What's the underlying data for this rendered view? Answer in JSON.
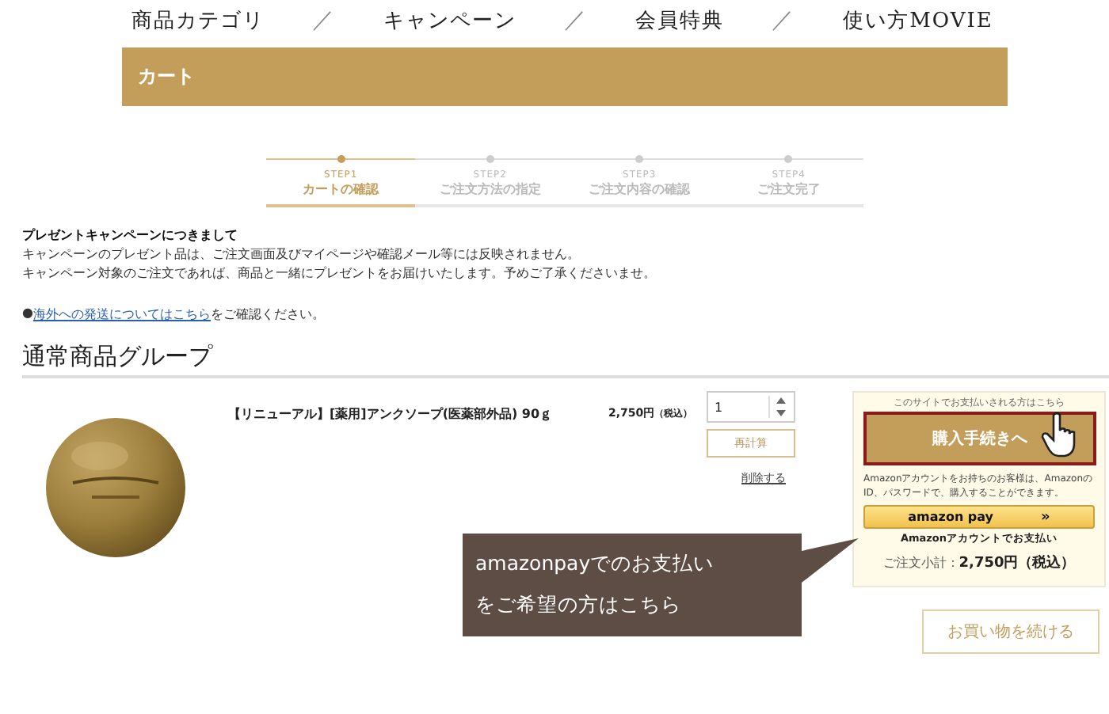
{
  "nav": [
    {
      "label": "商品カテゴリ"
    },
    {
      "label": "キャンペーン"
    },
    {
      "label": "会員特典"
    },
    {
      "label": "使い方MOVIE"
    }
  ],
  "nav_separator": "／",
  "header": {
    "title": "カート"
  },
  "steps": [
    {
      "step": "STEP1",
      "label": "カートの確認",
      "selected": true
    },
    {
      "step": "STEP2",
      "label": "ご注文方法の指定",
      "selected": false
    },
    {
      "step": "STEP3",
      "label": "ご注文内容の確認",
      "selected": false
    },
    {
      "step": "STEP4",
      "label": "ご注文完了",
      "selected": false
    }
  ],
  "notice": {
    "title": "プレゼントキャンペーンにつきまして",
    "lines": [
      "キャンペーンのプレゼント品は、ご注文画面及びマイページや確認メール等には反映されません。",
      "キャンペーン対象のご注文であれば、商品と一緒にプレゼントをお届けいたします。予めご了承くださいませ。"
    ]
  },
  "overseas": {
    "bullet": "●",
    "link": "海外への発送についてはこちら",
    "suffix": "をご確認ください。"
  },
  "group_title": "通常商品グループ",
  "item": {
    "name": "【リニューアル】[薬用]アンクソープ(医薬部外品) 90ｇ",
    "price": "2,750円",
    "tax": "（税込）",
    "quantity": "1",
    "recalc": "再計算",
    "delete": "削除する"
  },
  "checkout": {
    "intro": "このサイトでお支払いされる方はこちら",
    "purchase": "購入手続きへ",
    "amazon_note": "Amazonアカウントをお持ちのお客様は、AmazonのID、パスワードで、購入することができます。",
    "amazon_button": "amazon pay",
    "amazon_arrow": "»",
    "amazon_caption": "Amazonアカウントでお支払い",
    "subtotal_label": "ご注文小計：",
    "subtotal": "2,750円（税込）"
  },
  "tooltip": {
    "lines": [
      "amazonpayでのお支払い",
      "をご希望の方はこちら"
    ]
  },
  "continue": "お買い物を続ける"
}
